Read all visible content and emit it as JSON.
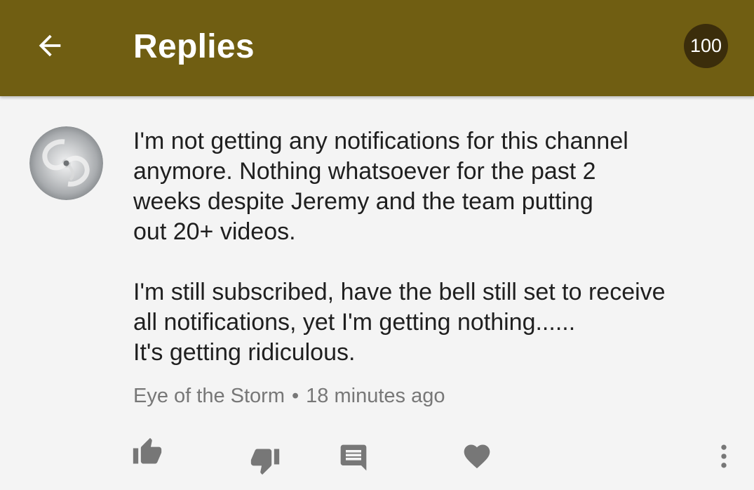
{
  "header": {
    "title": "Replies",
    "reply_count": "100",
    "back_icon": "arrow-back-icon"
  },
  "colors": {
    "app_bar": "#705e12",
    "badge": "#3b2d0b",
    "background": "#f4f4f4",
    "icon": "#777777"
  },
  "comment": {
    "avatar_icon": "storm-avatar",
    "body": "I'm not getting any notifications for this channel\nanymore. Nothing whatsoever for the past 2\nweeks despite Jeremy and the team putting\nout 20+ videos.\n\nI'm still subscribed, have the bell still set to receive\nall notifications, yet I'm getting nothing......\nIt's getting ridiculous.",
    "author": "Eye of the Storm",
    "separator": "•",
    "timestamp": "18 minutes ago"
  },
  "actions": [
    {
      "icon": "thumb-up-icon"
    },
    {
      "icon": "thumb-down-icon"
    },
    {
      "icon": "reply-icon"
    },
    {
      "icon": "heart-icon"
    },
    {
      "icon": "more-vert-icon"
    }
  ]
}
